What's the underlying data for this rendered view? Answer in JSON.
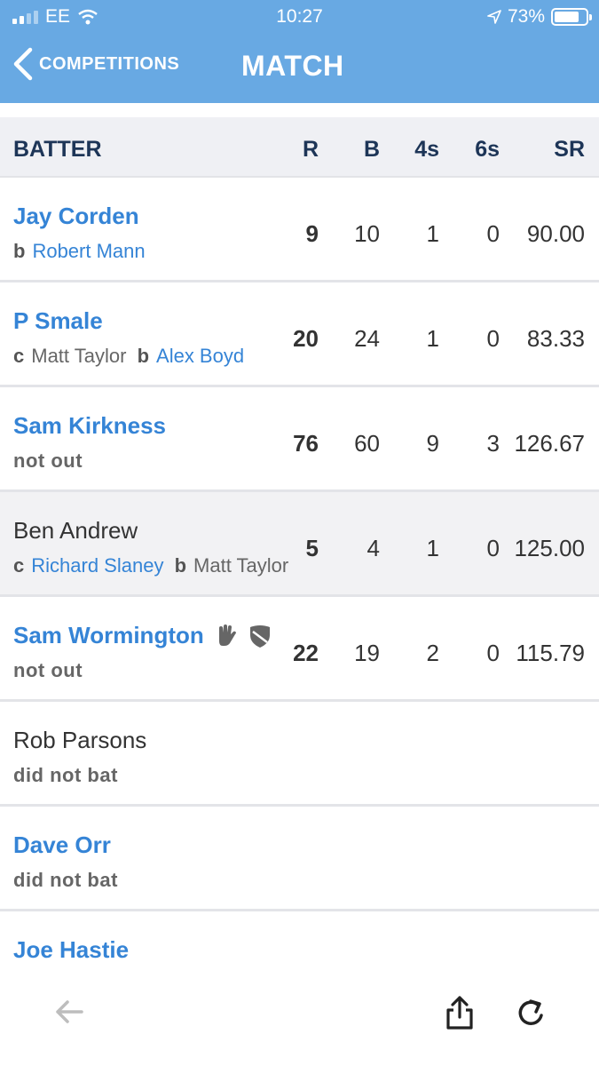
{
  "status_bar": {
    "carrier": "EE",
    "time": "10:27",
    "battery": "73%",
    "battery_level": 0.73
  },
  "nav": {
    "back_label": "COMPETITIONS",
    "title": "MATCH"
  },
  "table": {
    "headers": {
      "batter": "BATTER",
      "r": "R",
      "b": "B",
      "fours": "4s",
      "sixes": "6s",
      "sr": "SR"
    },
    "rows": [
      {
        "name": "Jay Corden",
        "dismissal": {
          "bowled_prefix": "b",
          "bowler": "Robert Mann"
        },
        "r": "9",
        "b": "10",
        "fours": "1",
        "sixes": "0",
        "sr": "90.00"
      },
      {
        "name": "P Smale",
        "dismissal": {
          "caught_prefix": "c",
          "fielder": "Matt Taylor",
          "bowled_prefix": "b",
          "bowler": "Alex Boyd"
        },
        "r": "20",
        "b": "24",
        "fours": "1",
        "sixes": "0",
        "sr": "83.33"
      },
      {
        "name": "Sam Kirkness",
        "status": "not out",
        "r": "76",
        "b": "60",
        "fours": "9",
        "sixes": "3",
        "sr": "126.67"
      },
      {
        "name": "Ben Andrew",
        "dismissal": {
          "caught_prefix": "c",
          "fielder": "Richard Slaney",
          "bowled_prefix": "b",
          "bowler": "Matt Taylor"
        },
        "r": "5",
        "b": "4",
        "fours": "1",
        "sixes": "0",
        "sr": "125.00"
      },
      {
        "name": "Sam Wormington",
        "status": "not out",
        "icons": [
          "wicketkeeper-gloves-icon",
          "captain-shield-icon"
        ],
        "r": "22",
        "b": "19",
        "fours": "2",
        "sixes": "0",
        "sr": "115.79"
      },
      {
        "name": "Rob Parsons",
        "status": "did not bat"
      },
      {
        "name": "Dave Orr",
        "status": "did not bat"
      },
      {
        "name": "Joe Hastie"
      }
    ]
  },
  "colors": {
    "header_bar": "#68a9e3",
    "link_blue": "#3584d6",
    "header_text": "#1d3557"
  }
}
